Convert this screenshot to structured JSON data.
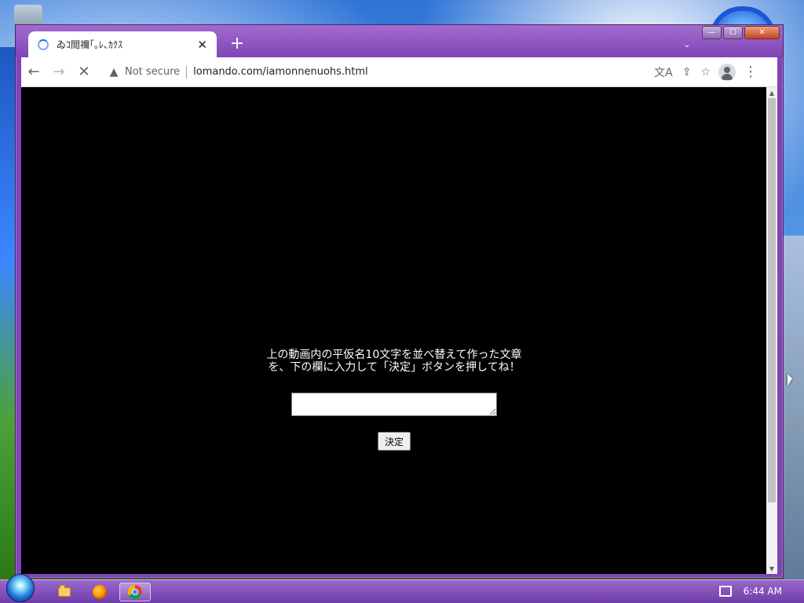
{
  "desktop": {
    "taskbar": {
      "clock": "6:44 AM",
      "apps": [
        {
          "name": "file-explorer"
        },
        {
          "name": "firefox"
        },
        {
          "name": "chrome"
        }
      ]
    }
  },
  "browser": {
    "tab": {
      "title": "ゐｺ閲禰｢｡ﾚ､ｶｸｽ",
      "close_label": "✕"
    },
    "new_tab_label": "+",
    "toolbar": {
      "back_label": "←",
      "forward_label": "→",
      "stop_label": "✕",
      "not_secure_label": "Not secure",
      "url": "lomando.com/iamonnenuohs.html",
      "translate_icon": "文A",
      "share_icon": "⇪",
      "bookmark_icon": "☆",
      "menu_icon": "⋮"
    },
    "window_controls": {
      "minimize": "—",
      "maximize": "☐",
      "close": "✕"
    }
  },
  "page": {
    "instruction": "上の動画内の平仮名10文字を並べ替えて作った文章\nを、下の欄に入力して「決定」ボタンを押してね！",
    "answer_value": "",
    "answer_placeholder": "",
    "submit_label": "決定"
  },
  "colors": {
    "accent": "#1a73e8",
    "window_frame": "#7f44b5",
    "page_background": "#000000",
    "text_on_page": "#ffffff"
  }
}
